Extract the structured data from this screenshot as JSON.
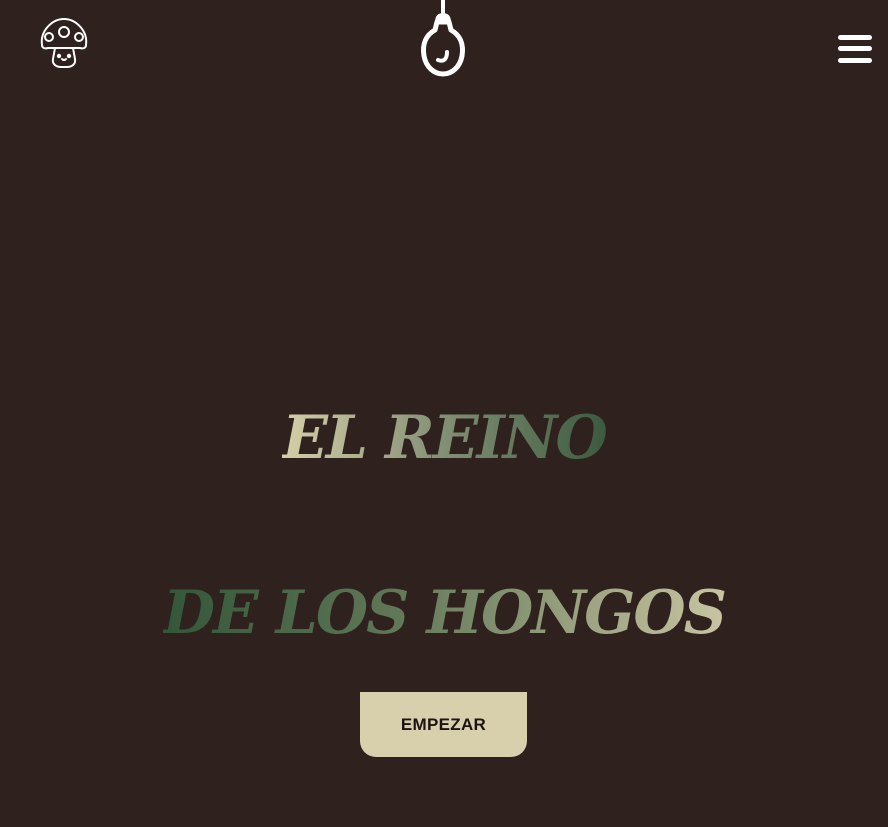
{
  "header": {
    "logo_icon": "mushroom-icon",
    "lamp_icon": "light-bulb-icon",
    "menu_icon": "hamburger-menu-icon"
  },
  "hero": {
    "title_line1": "EL REINO",
    "title_line2": "DE LOS HONGOS",
    "cta_label": "EMPEZAR"
  },
  "colors": {
    "background": "#2e211e",
    "button_background": "#d8d0ad",
    "title_light": "#d6cfa8",
    "title_dark": "#3b5a40"
  }
}
